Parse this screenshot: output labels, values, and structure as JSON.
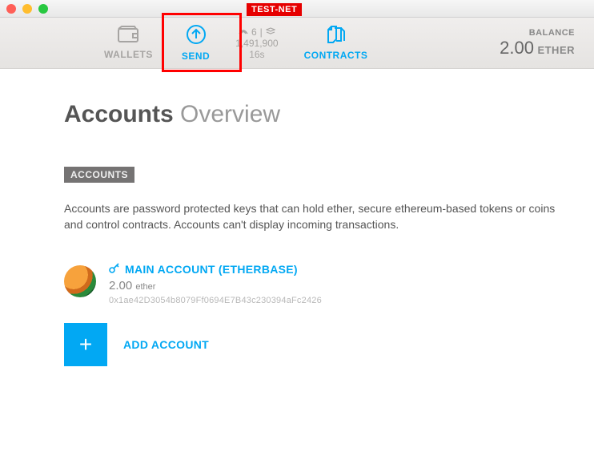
{
  "nav": {
    "wallets": "WALLETS",
    "send": "SEND",
    "contracts": "CONTRACTS"
  },
  "testnet_badge": "TEST-NET",
  "status": {
    "peers": "6",
    "block": "1,491,900",
    "time": "16s"
  },
  "balance": {
    "label": "BALANCE",
    "amount": "2.00",
    "unit": "ETHER"
  },
  "page": {
    "title_first": "Accounts",
    "title_rest": "Overview",
    "section_label": "ACCOUNTS",
    "description": "Accounts are password protected keys that can hold ether, secure ethereum-based tokens or coins and control contracts. Accounts can't display incoming transactions."
  },
  "account": {
    "name": "MAIN ACCOUNT (ETHERBASE)",
    "balance": "2.00",
    "unit": "ether",
    "address": "0x1ae42D3054b8079Ff0694E7B43c230394aFc2426"
  },
  "add_account_label": "ADD ACCOUNT"
}
